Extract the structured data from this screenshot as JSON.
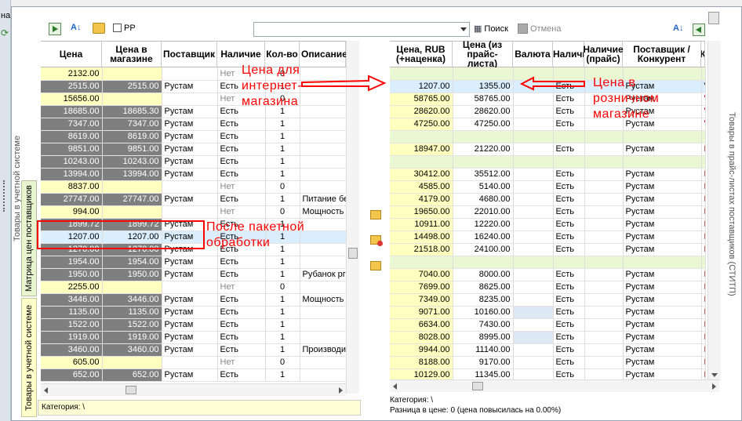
{
  "window": {
    "left_top_fragment": "на"
  },
  "toolbar": {
    "pp_label": "PP",
    "search_label": "Поиск",
    "cancel_label": "Отмена",
    "search_value": ""
  },
  "side_tabs": {
    "system_goods": "Товары в учетной системе",
    "supplier_matrix": "Матрица цен поставщиков",
    "system_goods2": "Товары в учетной системе",
    "right_label": "Товары в прайс-листах поставщиков (СТИТП)"
  },
  "left_grid": {
    "headers": [
      "Цена",
      "Цена в магазине",
      "Поставщик",
      "Наличие",
      "Кол-во",
      "Описание"
    ],
    "rows": [
      [
        "2132.00",
        "",
        "",
        "Нет",
        "0",
        ""
      ],
      [
        "2515.00",
        "2515.00",
        "Рустам",
        "Есть",
        "1",
        ""
      ],
      [
        "15656.00",
        "",
        "",
        "Нет",
        "0",
        ""
      ],
      [
        "18685.00",
        "18685.30",
        "Рустам",
        "Есть",
        "1",
        ""
      ],
      [
        "7347.00",
        "7347.00",
        "Рустам",
        "Есть",
        "1",
        ""
      ],
      [
        "8619.00",
        "8619.00",
        "Рустам",
        "Есть",
        "1",
        ""
      ],
      [
        "9851.00",
        "9851.00",
        "Рустам",
        "Есть",
        "1",
        ""
      ],
      [
        "10243.00",
        "10243.00",
        "Рустам",
        "Есть",
        "1",
        ""
      ],
      [
        "13994.00",
        "13994.00",
        "Рустам",
        "Есть",
        "1",
        ""
      ],
      [
        "8837.00",
        "",
        "",
        "Нет",
        "0",
        ""
      ],
      [
        "27747.00",
        "27747.00",
        "Рустам",
        "Есть",
        "1",
        "Питание бе"
      ],
      [
        "994.00",
        "",
        "",
        "Нет",
        "0",
        "Мощность"
      ],
      [
        "1899.72",
        "1899.72",
        "Рустам",
        "Есть",
        "1",
        ""
      ],
      [
        "1207.00",
        "1207.00",
        "Рустам",
        "Есть",
        "1",
        ""
      ],
      [
        "1270.00",
        "1270.00",
        "Рустам",
        "Есть",
        "1",
        ""
      ],
      [
        "1954.00",
        "1954.00",
        "Рустам",
        "Есть",
        "1",
        ""
      ],
      [
        "1950.00",
        "1950.00",
        "Рустам",
        "Есть",
        "1",
        "Рубанок рго"
      ],
      [
        "2255.00",
        "",
        "",
        "Нет",
        "0",
        ""
      ],
      [
        "3446.00",
        "3446.00",
        "Рустам",
        "Есть",
        "1",
        "Мощность ("
      ],
      [
        "1135.00",
        "1135.00",
        "Рустам",
        "Есть",
        "1",
        ""
      ],
      [
        "1522.00",
        "1522.00",
        "Рустам",
        "Есть",
        "1",
        ""
      ],
      [
        "1919.00",
        "1919.00",
        "Рустам",
        "Есть",
        "1",
        ""
      ],
      [
        "3460.00",
        "3460.00",
        "Рустам",
        "Есть",
        "1",
        "Производит"
      ],
      [
        "605.00",
        "",
        "",
        "Нет",
        "0",
        ""
      ],
      [
        "652.00",
        "652.00",
        "Рустам",
        "Есть",
        "1",
        ""
      ]
    ],
    "category_label": "Категория: \\"
  },
  "right_grid": {
    "headers": [
      "Цена, RUB (+наценка)",
      "Цена (из прайс-листа)",
      "Валюта",
      "Наличие",
      "Наличие (прайс)",
      "Поставщик / Конкурент",
      "К"
    ],
    "rows": [
      [
        "",
        "",
        "",
        "",
        "",
        "",
        ""
      ],
      [
        "1207.00",
        "1355.00",
        "",
        "Есть",
        "",
        "Рустам",
        "V"
      ],
      [
        "58765.00",
        "58765.00",
        "",
        "Есть",
        "",
        "Рустам",
        "V"
      ],
      [
        "28620.00",
        "28620.00",
        "",
        "Есть",
        "",
        "Рустам",
        "V"
      ],
      [
        "47250.00",
        "47250.00",
        "",
        "Есть",
        "",
        "Рустам",
        "V"
      ],
      [
        "",
        "",
        "",
        "",
        "",
        "",
        ""
      ],
      [
        "18947.00",
        "21220.00",
        "",
        "Есть",
        "",
        "Рустам",
        "E"
      ],
      [
        "",
        "",
        "",
        "",
        "",
        "",
        ""
      ],
      [
        "30412.00",
        "35512.00",
        "",
        "Есть",
        "",
        "Рустам",
        "E"
      ],
      [
        "4585.00",
        "5140.00",
        "",
        "Есть",
        "",
        "Рустам",
        "E"
      ],
      [
        "4179.00",
        "4680.00",
        "",
        "Есть",
        "",
        "Рустам",
        "E"
      ],
      [
        "19650.00",
        "22010.00",
        "",
        "Есть",
        "",
        "Рустам",
        "E"
      ],
      [
        "10911.00",
        "12220.00",
        "",
        "Есть",
        "",
        "Рустам",
        "E"
      ],
      [
        "14498.00",
        "16240.00",
        "",
        "Есть",
        "",
        "Рустам",
        "E"
      ],
      [
        "21518.00",
        "24100.00",
        "",
        "Есть",
        "",
        "Рустам",
        "E"
      ],
      [
        "",
        "",
        "",
        "",
        "",
        "",
        ""
      ],
      [
        "7040.00",
        "8000.00",
        "",
        "Есть",
        "",
        "Рустам",
        "E"
      ],
      [
        "7699.00",
        "8625.00",
        "",
        "Есть",
        "",
        "Рустам",
        "E"
      ],
      [
        "7349.00",
        "8235.00",
        "",
        "Есть",
        "",
        "Рустам",
        "E"
      ],
      [
        "9071.00",
        "10160.00",
        "",
        "Есть",
        "",
        "Рустам",
        "E"
      ],
      [
        "6634.00",
        "7430.00",
        "",
        "Есть",
        "",
        "Рустам",
        "E"
      ],
      [
        "8028.00",
        "8995.00",
        "",
        "Есть",
        "",
        "Рустам",
        "E"
      ],
      [
        "9944.00",
        "11140.00",
        "",
        "Есть",
        "",
        "Рустам",
        "E"
      ],
      [
        "8188.00",
        "9170.00",
        "",
        "Есть",
        "",
        "Рустам",
        "E"
      ],
      [
        "10129.00",
        "11345.00",
        "",
        "Есть",
        "",
        "Рустам",
        "E"
      ]
    ],
    "category_label": "Категория: \\",
    "price_diff": "Разница в цене: 0  (цена повысилась на 0.00%)"
  },
  "annotations": {
    "online_price": "Цена для интернет-магазина",
    "retail_price": "Цена в розничном магазине",
    "after_batch": "После пакетной обработки"
  },
  "colors": {
    "annotation": "#ff0000",
    "selected_row": "#dbeefd",
    "yellow_cell": "#ffffc0",
    "dark_cell": "#7f7f7f",
    "group_row": "#e9f7d2"
  }
}
